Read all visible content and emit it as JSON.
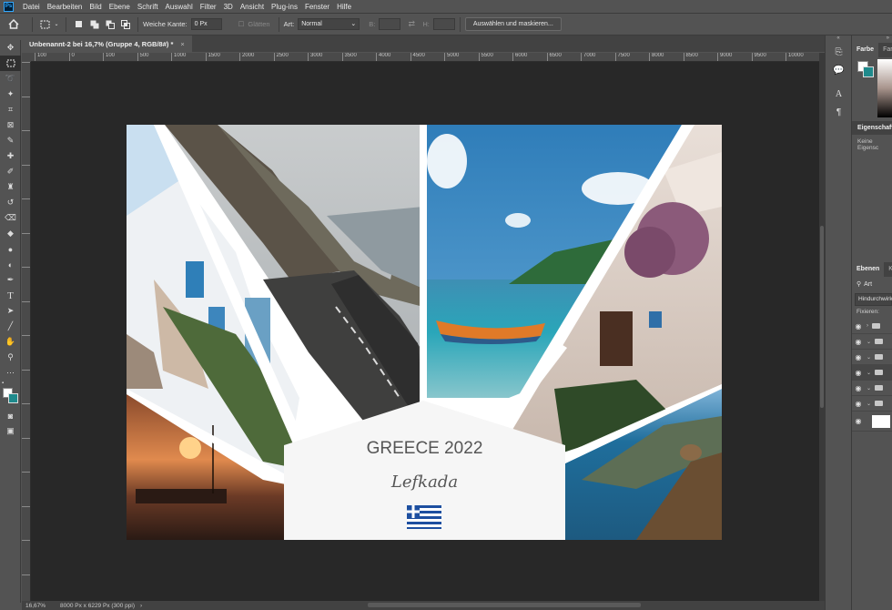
{
  "app": {
    "logo_text": "Ps"
  },
  "menu": [
    "Datei",
    "Bearbeiten",
    "Bild",
    "Ebene",
    "Schrift",
    "Auswahl",
    "Filter",
    "3D",
    "Ansicht",
    "Plug-ins",
    "Fenster",
    "Hilfe"
  ],
  "options": {
    "feather_label": "Weiche Kante:",
    "feather_value": "0 Px",
    "antialias_label": "Glätten",
    "style_label": "Art:",
    "style_value": "Normal",
    "width_label": "B:",
    "height_label": "H:",
    "select_mask_label": "Auswählen und maskieren..."
  },
  "document": {
    "tab_title": "Unbenannt-2 bei 16,7% (Gruppe 4, RGB/8#) *",
    "close_glyph": "×",
    "title_text": "GREECE 2022",
    "subtitle_text": "Lefkada"
  },
  "ruler": {
    "h_labels": [
      "100",
      "0",
      "100",
      "500",
      "1000",
      "1500",
      "2000",
      "2500",
      "3000",
      "3500",
      "4000",
      "4500",
      "5000",
      "5500",
      "6000",
      "6500",
      "7000",
      "7500",
      "8000",
      "8500",
      "9000",
      "9500",
      "10000"
    ]
  },
  "status": {
    "zoom": "16,67%",
    "doc_size": "8000 Px x 6229 Px (300 ppi)"
  },
  "panels": {
    "color_tab": "Farbe",
    "color_tab2": "Farb",
    "properties_tab": "Eigenschafte",
    "properties_empty": "Keine Eigensc",
    "layers_tab": "Ebenen",
    "layers_tab2": "K",
    "layers_filter": "Art",
    "blend_mode": "Hindurchwirk",
    "lock_label": "Fixieren:"
  },
  "colors": {
    "foreground": "#ffffff",
    "background": "#1f8a8c"
  }
}
